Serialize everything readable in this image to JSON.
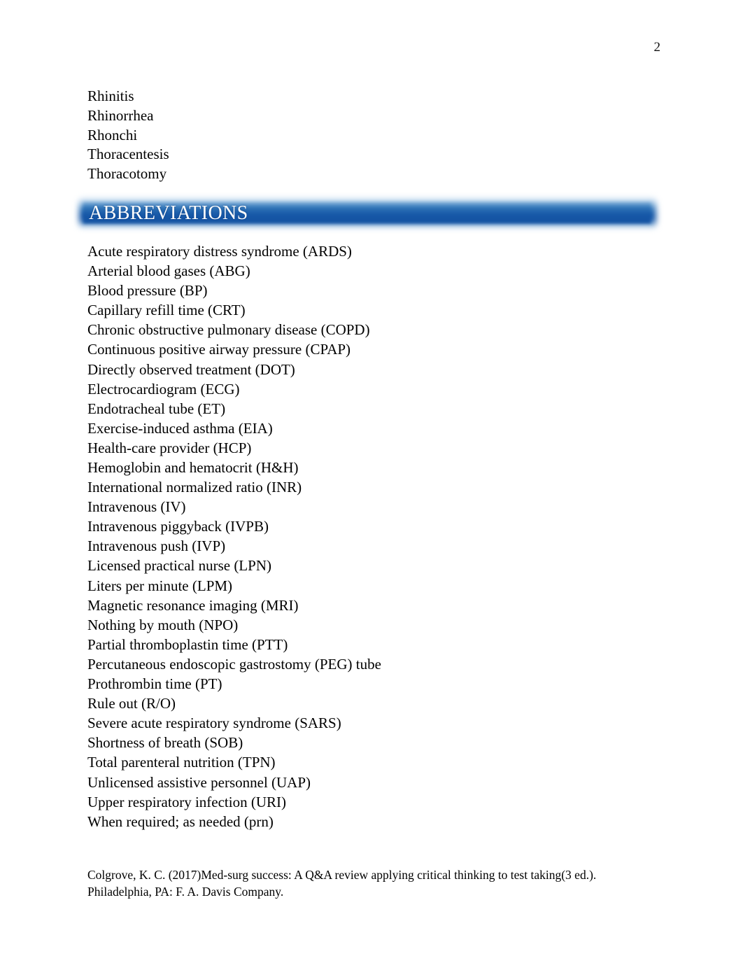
{
  "page": {
    "number": "2"
  },
  "top_terms": [
    "Rhinitis",
    "Rhinorrhea",
    "Rhonchi",
    "Thoracentesis",
    "Thoracotomy"
  ],
  "section": {
    "heading": "ABBREVIATIONS",
    "banner_color_top": "#96BEE2",
    "banner_color_mid": "#1758A8",
    "banner_color_deep": "#1553A2",
    "heading_text_color": "#FFFFFF"
  },
  "abbreviations": [
    "Acute respiratory distress syndrome (ARDS)",
    "Arterial blood gases (ABG)",
    "Blood pressure (BP)",
    "Capillary refill time (CRT)",
    "Chronic obstructive pulmonary disease (COPD)",
    "Continuous positive airway pressure (CPAP)",
    "Directly observed treatment (DOT)",
    "Electrocardiogram (ECG)",
    "Endotracheal tube (ET)",
    "Exercise-induced asthma (EIA)",
    "Health-care provider (HCP)",
    "Hemoglobin and hematocrit (H&H)",
    "International normalized ratio (INR)",
    "Intravenous (IV)",
    "Intravenous piggyback (IVPB)",
    "Intravenous push (IVP)",
    "Licensed practical nurse (LPN)",
    "Liters per minute (LPM)",
    "Magnetic resonance imaging (MRI)",
    "Nothing by mouth (NPO)",
    "Partial thromboplastin time (PTT)",
    "Percutaneous endoscopic gastrostomy (PEG) tube",
    "Prothrombin time (PT)",
    "Rule out (R/O)",
    "Severe acute respiratory syndrome (SARS)",
    "Shortness of breath (SOB)",
    "Total parenteral nutrition (TPN)",
    "Unlicensed assistive personnel (UAP)",
    "Upper respiratory infection (URI)",
    "When required; as needed (prn)"
  ],
  "citation": {
    "line1": "Colgrove, K. C. (2017)Med-surg success: A Q&A review applying critical thinking to test taking(3 ed.).",
    "line2": "Philadelphia, PA: F. A. Davis Company."
  }
}
